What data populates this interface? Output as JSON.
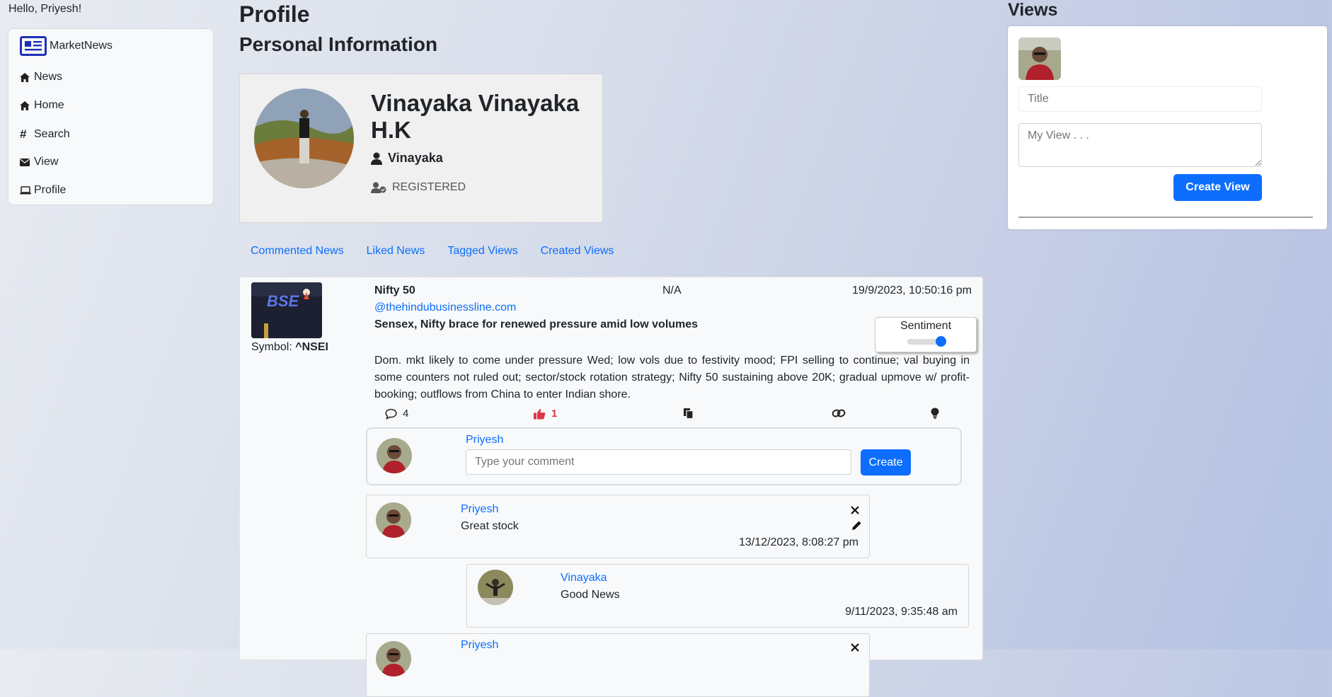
{
  "greeting": "Hello, Priyesh!",
  "sidebar": {
    "brand": "MarketNews",
    "items": [
      {
        "label": "News",
        "icon": "home-icon"
      },
      {
        "label": "Home",
        "icon": "home-icon"
      },
      {
        "label": "Search",
        "icon": "hash-icon"
      },
      {
        "label": "View",
        "icon": "envelope-icon"
      },
      {
        "label": "Profile",
        "icon": "laptop-icon"
      }
    ]
  },
  "profile": {
    "title": "Profile",
    "section_title": "Personal Information",
    "full_name": "Vinayaka Vinayaka H.K",
    "username": "Vinayaka",
    "status": "REGISTERED"
  },
  "tabs": [
    "Commented News",
    "Liked News",
    "Tagged Views",
    "Created Views"
  ],
  "news": {
    "symbol_label": "Symbol:",
    "symbol": "^NSEI",
    "name": "Nifty 50",
    "na": "N/A",
    "date": "19/9/2023, 10:50:16 pm",
    "source": "@thehindubusinessline.com",
    "headline": "Sensex, Nifty brace for renewed pressure amid low volumes",
    "sentiment_label": "Sentiment",
    "body": "Dom. mkt likely to come under pressure Wed; low vols due to festivity mood; FPI selling to continue; val buying in some counters not ruled out; sector/stock rotation strategy; Nifty 50 sustaining above 20K; gradual upmove w/ profit-booking; outflows from China to enter Indian shore.",
    "comments_count": "4",
    "likes_count": "1",
    "like_color": "#dc3545"
  },
  "new_comment": {
    "user": "Priyesh",
    "placeholder": "Type your comment",
    "button": "Create"
  },
  "comments": [
    {
      "user": "Priyesh",
      "text": "Great stock",
      "date": "13/12/2023, 8:08:27 pm"
    },
    {
      "user": "Vinayaka",
      "text": "Good News",
      "date": "9/11/2023, 9:35:48 am"
    },
    {
      "user": "Priyesh"
    }
  ],
  "views": {
    "title": "Views",
    "title_placeholder": "Title",
    "textarea_placeholder": "My View . . .",
    "button": "Create View"
  },
  "colors": {
    "accent": "#0d6efd",
    "like": "#dc3545"
  }
}
